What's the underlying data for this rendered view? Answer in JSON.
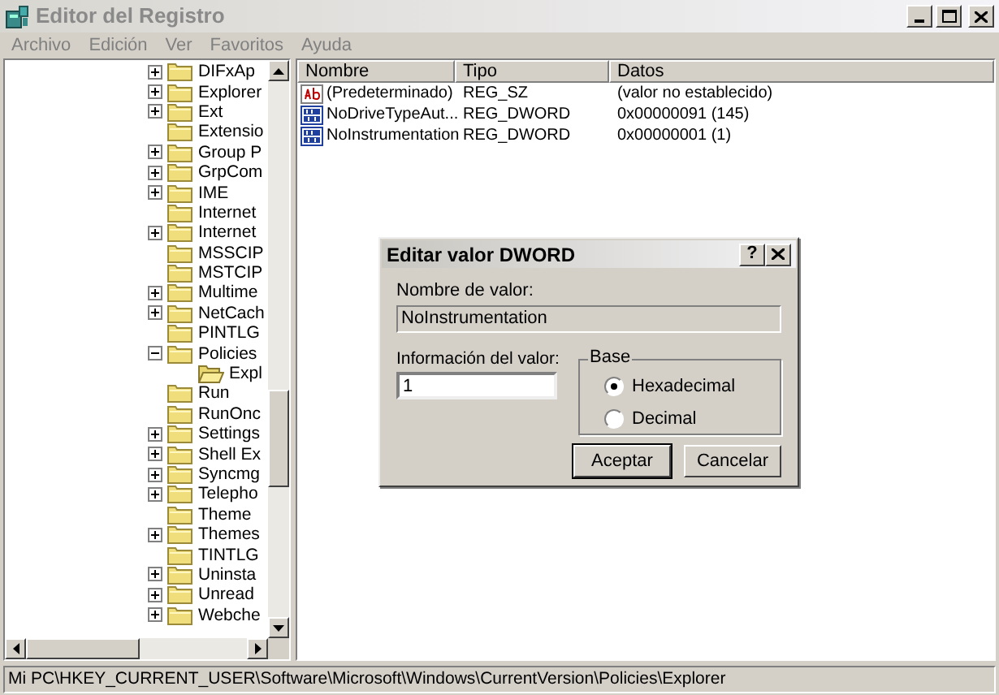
{
  "window": {
    "title": "Editor del Registro"
  },
  "menu": [
    "Archivo",
    "Edición",
    "Ver",
    "Favoritos",
    "Ayuda"
  ],
  "tree": [
    {
      "label": "DIFxAp",
      "kind": "collapsed"
    },
    {
      "label": "Explorer",
      "kind": "collapsed"
    },
    {
      "label": "Ext",
      "kind": "collapsed"
    },
    {
      "label": "Extensio",
      "kind": "leaf"
    },
    {
      "label": "Group P",
      "kind": "collapsed"
    },
    {
      "label": "GrpCom",
      "kind": "collapsed"
    },
    {
      "label": "IME",
      "kind": "collapsed"
    },
    {
      "label": "Internet",
      "kind": "leaf"
    },
    {
      "label": "Internet",
      "kind": "collapsed"
    },
    {
      "label": "MSSCIP",
      "kind": "leaf"
    },
    {
      "label": "MSTCIP",
      "kind": "leaf"
    },
    {
      "label": "Multime",
      "kind": "collapsed"
    },
    {
      "label": "NetCach",
      "kind": "collapsed"
    },
    {
      "label": "PINTLG",
      "kind": "leaf"
    },
    {
      "label": "Policies",
      "kind": "expanded",
      "children": [
        {
          "label": "Expl",
          "kind": "open"
        }
      ]
    },
    {
      "label": "Run",
      "kind": "leaf"
    },
    {
      "label": "RunOnc",
      "kind": "leaf"
    },
    {
      "label": "Settings",
      "kind": "collapsed"
    },
    {
      "label": "Shell Ex",
      "kind": "collapsed"
    },
    {
      "label": "Syncmg",
      "kind": "collapsed"
    },
    {
      "label": "Telepho",
      "kind": "collapsed"
    },
    {
      "label": "Theme",
      "kind": "leaf"
    },
    {
      "label": "Themes",
      "kind": "collapsed"
    },
    {
      "label": "TINTLG",
      "kind": "leaf"
    },
    {
      "label": "Uninsta",
      "kind": "collapsed"
    },
    {
      "label": "Unread",
      "kind": "collapsed"
    },
    {
      "label": "Webche",
      "kind": "collapsed"
    }
  ],
  "table": {
    "columns": [
      "Nombre",
      "Tipo",
      "Datos"
    ],
    "rows": [
      {
        "kind": "string",
        "cells": [
          "(Predeterminado)",
          "REG_SZ",
          "(valor no establecido)"
        ]
      },
      {
        "kind": "binary",
        "cells": [
          "NoDriveTypeAut...",
          "REG_DWORD",
          "0x00000091 (145)"
        ]
      },
      {
        "kind": "binary",
        "cells": [
          "NoInstrumentation",
          "REG_DWORD",
          "0x00000001 (1)"
        ]
      }
    ]
  },
  "dialog": {
    "title": "Editar valor DWORD",
    "help": "?",
    "name_label": "Nombre de valor:",
    "name_value": "NoInstrumentation",
    "data_label": "Información del valor:",
    "data_value": "1",
    "base_label": "Base",
    "base_options": [
      {
        "label": "Hexadecimal",
        "selected": true
      },
      {
        "label": "Decimal",
        "selected": false
      }
    ],
    "buttons": [
      {
        "label": "Aceptar",
        "default": true
      },
      {
        "label": "Cancelar",
        "default": false
      }
    ]
  },
  "status_bar": "Mi PC\\HKEY_CURRENT_USER\\Software\\Microsoft\\Windows\\CurrentVersion\\Policies\\Explorer"
}
